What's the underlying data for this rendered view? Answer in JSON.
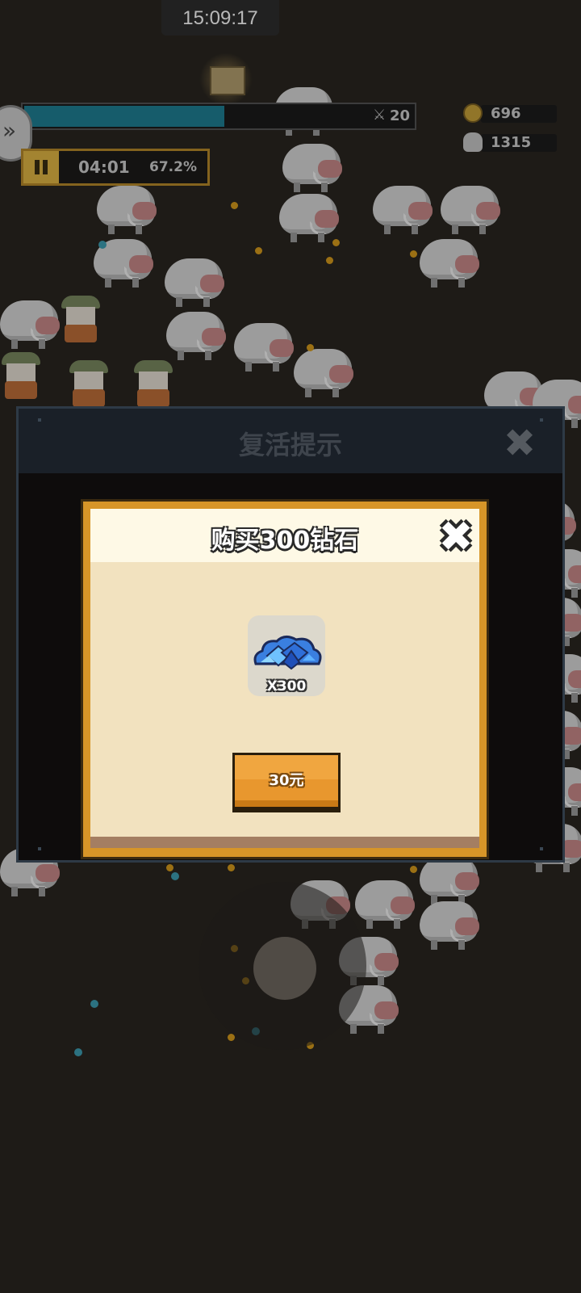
{
  "status_bar": {
    "time": "15:09:17"
  },
  "hud": {
    "level": "20",
    "xp_progress": 0.51,
    "timer": "04:01",
    "progress_percent": "67.2%",
    "coins": "696",
    "kills": "1315"
  },
  "revive_panel": {
    "title": "复活提示"
  },
  "purchase_dialog": {
    "title": "购买300钻石",
    "item_count": "X300",
    "buy_button": "30元"
  },
  "colors": {
    "xp_fill": "#1f8095",
    "dialog_border": "#d79528",
    "buy_button": "#e8972e",
    "gem": "#2f7fe0"
  },
  "icons": [
    "chest-icon",
    "sword-icon",
    "coin-icon",
    "skull-icon",
    "pause-icon",
    "arrow-right-icon",
    "close-icon",
    "diamond-icon"
  ]
}
